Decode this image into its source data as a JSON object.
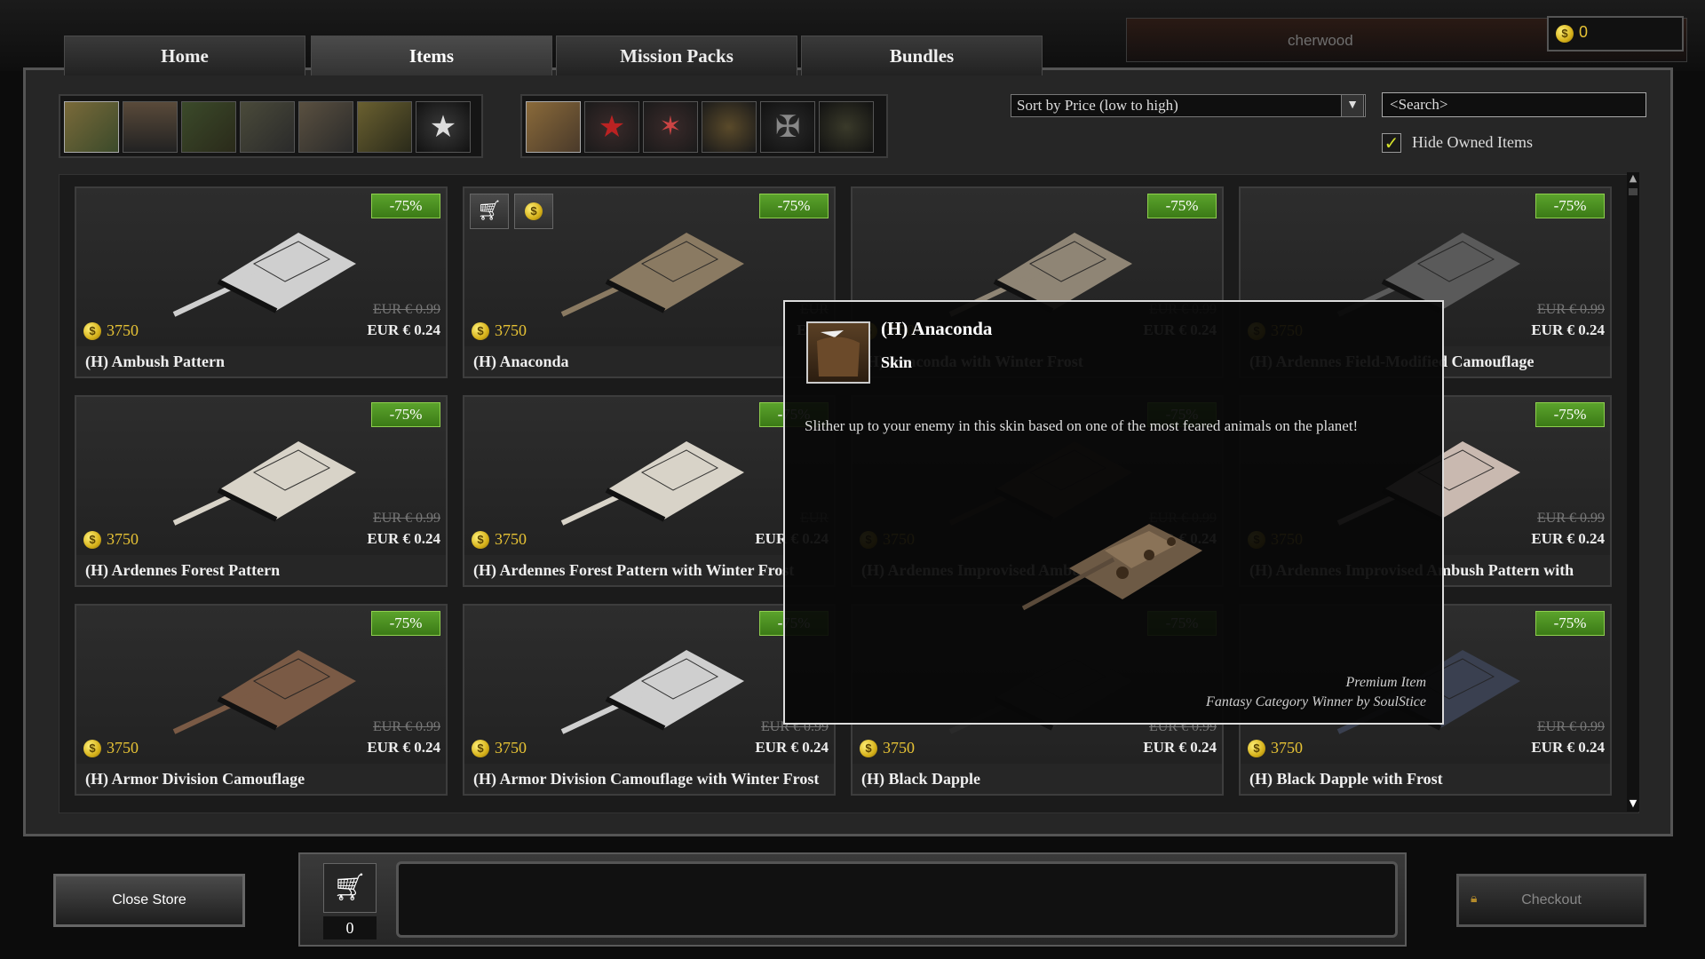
{
  "header": {
    "player_name": "cherwood",
    "coins": "0"
  },
  "tabs": [
    {
      "label": "Home"
    },
    {
      "label": "Items"
    },
    {
      "label": "Mission Packs"
    },
    {
      "label": "Bundles"
    }
  ],
  "filters": {
    "sort_value": "Sort by Price (low to high)",
    "search_placeholder": "<Search>",
    "hide_owned_label": "Hide Owned Items",
    "hide_owned_checked": true
  },
  "items": [
    {
      "name": "(H) Ambush Pattern",
      "discount": "-75%",
      "coin_price": "3750",
      "old_price": "EUR € 0.99",
      "price": "EUR € 0.24"
    },
    {
      "name": "(H) Anaconda",
      "discount": "-75%",
      "coin_price": "3750",
      "old_price": "EUR",
      "price": "EUR"
    },
    {
      "name": "(H) Anaconda with Winter Frost",
      "discount": "-75%",
      "coin_price": "3750",
      "old_price": "EUR € 0.99",
      "price": "EUR € 0.24"
    },
    {
      "name": "(H) Ardennes Field-Modified Camouflage",
      "discount": "-75%",
      "coin_price": "3750",
      "old_price": "EUR € 0.99",
      "price": "EUR € 0.24"
    },
    {
      "name": "(H) Ardennes Forest Pattern",
      "discount": "-75%",
      "coin_price": "3750",
      "old_price": "EUR € 0.99",
      "price": "EUR € 0.24"
    },
    {
      "name": "(H) Ardennes Forest Pattern with Winter Frost",
      "discount": "-75%",
      "coin_price": "3750",
      "old_price": "EUR",
      "price": "EUR € 0.24"
    },
    {
      "name": "(H) Ardennes Improvised Ambush",
      "discount": "-75%",
      "coin_price": "3750",
      "old_price": "EUR € 0.99",
      "price": "EUR € 0.24"
    },
    {
      "name": "(H) Ardennes Improvised Ambush Pattern with",
      "discount": "-75%",
      "coin_price": "3750",
      "old_price": "EUR € 0.99",
      "price": "EUR € 0.24"
    },
    {
      "name": "(H) Armor Division Camouflage",
      "discount": "-75%",
      "coin_price": "3750",
      "old_price": "EUR € 0.99",
      "price": "EUR € 0.24"
    },
    {
      "name": "(H) Armor Division Camouflage with Winter Frost",
      "discount": "-75%",
      "coin_price": "3750",
      "old_price": "EUR € 0.99",
      "price": "EUR € 0.24"
    },
    {
      "name": "(H) Black Dapple",
      "discount": "-75%",
      "coin_price": "3750",
      "old_price": "EUR € 0.99",
      "price": "EUR € 0.24"
    },
    {
      "name": "(H) Black Dapple with Frost",
      "discount": "-75%",
      "coin_price": "3750",
      "old_price": "EUR € 0.99",
      "price": "EUR € 0.24"
    }
  ],
  "tooltip": {
    "title": "(H) Anaconda",
    "type": "Skin",
    "description": "Slither up to your enemy in this skin based on one of the most feared animals on the planet!",
    "premium": "Premium Item",
    "winner": "Fantasy Category Winner by SoulStice"
  },
  "footer": {
    "close_label": "Close Store",
    "cart_count": "0",
    "checkout_label": "Checkout"
  },
  "colors": {
    "discount_badge": "#4a8f22",
    "coin_text": "#e6c235",
    "frame": "#262626"
  }
}
